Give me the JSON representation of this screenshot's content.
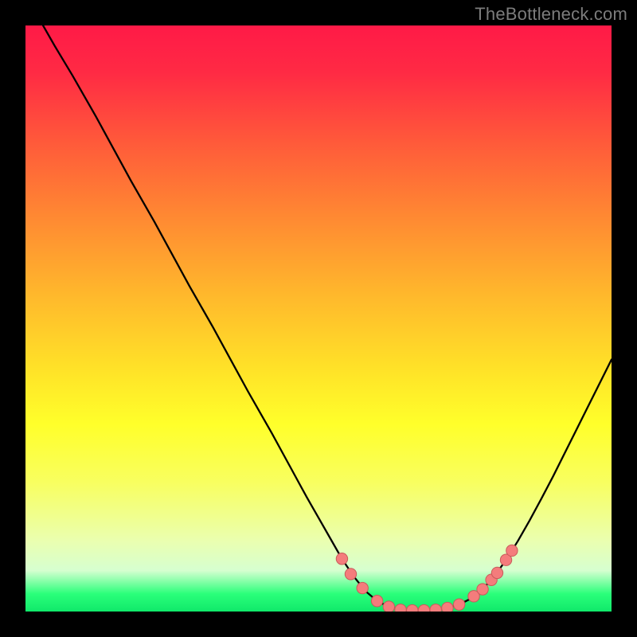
{
  "watermark": "TheBottleneck.com",
  "colors": {
    "background": "#000000",
    "curve": "#000000",
    "points_fill": "#f47c7c",
    "points_stroke": "#c95a5a"
  },
  "chart_data": {
    "type": "line",
    "title": "",
    "xlabel": "",
    "ylabel": "",
    "xlim": [
      0,
      100
    ],
    "ylim": [
      0,
      100
    ],
    "series": [
      {
        "name": "curve",
        "x": [
          3,
          5,
          8,
          10,
          12,
          15,
          18,
          20,
          22,
          25,
          28,
          30,
          32,
          35,
          38,
          40,
          42,
          45,
          48,
          50,
          52,
          54,
          56,
          58,
          60,
          62,
          64,
          66,
          68,
          70,
          72,
          74,
          76,
          78,
          80,
          82,
          84,
          86,
          88,
          90,
          92,
          94,
          96,
          98,
          100
        ],
        "y": [
          100,
          96.5,
          91.5,
          88,
          84.5,
          79,
          73.5,
          70,
          66.5,
          61,
          55.5,
          52,
          48.5,
          43,
          37.5,
          34,
          30.5,
          25,
          19.5,
          16,
          12.5,
          9,
          6,
          3.5,
          1.8,
          0.8,
          0.3,
          0.2,
          0.2,
          0.3,
          0.6,
          1.2,
          2.2,
          3.8,
          6,
          8.8,
          12,
          15.5,
          19.2,
          23,
          27,
          31,
          35,
          39,
          43
        ]
      }
    ],
    "points": [
      {
        "x": 54,
        "y": 9.0
      },
      {
        "x": 55.5,
        "y": 6.4
      },
      {
        "x": 57.5,
        "y": 4.0
      },
      {
        "x": 60,
        "y": 1.8
      },
      {
        "x": 62,
        "y": 0.8
      },
      {
        "x": 64,
        "y": 0.3
      },
      {
        "x": 66,
        "y": 0.2
      },
      {
        "x": 68,
        "y": 0.2
      },
      {
        "x": 70,
        "y": 0.3
      },
      {
        "x": 72,
        "y": 0.6
      },
      {
        "x": 74,
        "y": 1.2
      },
      {
        "x": 76.5,
        "y": 2.6
      },
      {
        "x": 78,
        "y": 3.8
      },
      {
        "x": 79.5,
        "y": 5.4
      },
      {
        "x": 80.5,
        "y": 6.6
      },
      {
        "x": 82,
        "y": 8.8
      },
      {
        "x": 83.0,
        "y": 10.4
      }
    ]
  }
}
